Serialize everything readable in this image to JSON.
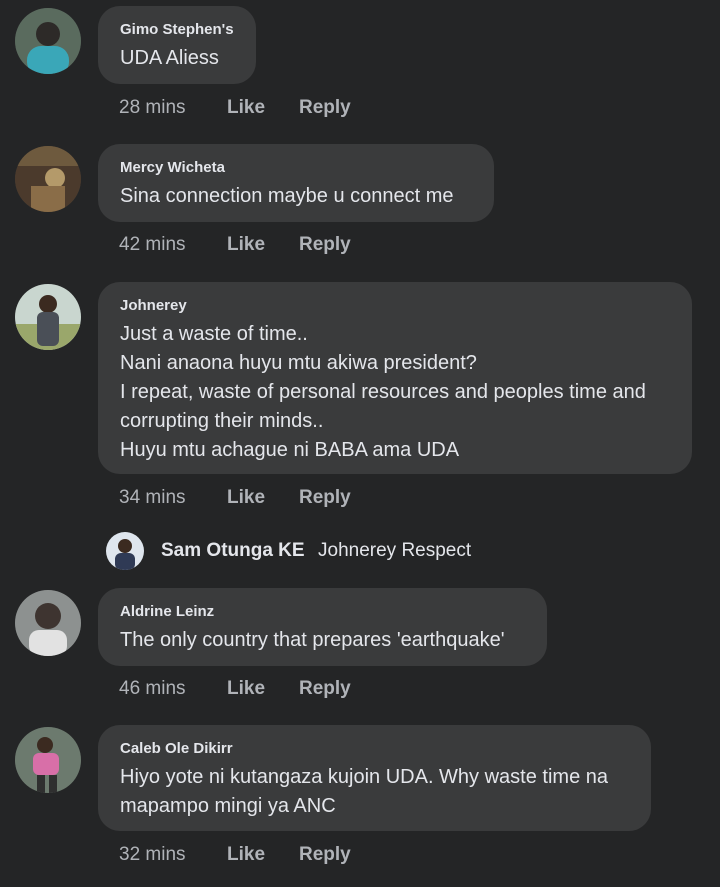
{
  "comments": [
    {
      "author": "Gimo Stephen's",
      "lines": [
        "UDA Aliess"
      ],
      "time": "28 mins",
      "like": "Like",
      "reply": "Reply"
    },
    {
      "author": "Mercy Wicheta",
      "lines": [
        "Sina connection maybe u connect me"
      ],
      "time": "42 mins",
      "like": "Like",
      "reply": "Reply"
    },
    {
      "author": "Johnerey",
      "lines": [
        "Just a waste of time..",
        "Nani anaona huyu mtu akiwa president?",
        "I repeat, waste of personal resources and peoples time and",
        "corrupting their minds..",
        "Huyu mtu achague ni BABA ama UDA"
      ],
      "time": "34 mins",
      "like": "Like",
      "reply": "Reply"
    },
    {
      "author": "Aldrine Leinz",
      "lines": [
        "The only country that prepares 'earthquake'"
      ],
      "time": "46 mins",
      "like": "Like",
      "reply": "Reply"
    },
    {
      "author": "Caleb Ole Dikirr",
      "lines": [
        "Hiyo yote ni kutangaza kujoin UDA. Why waste time na",
        "mapampo mingi ya ANC"
      ],
      "time": "32 mins",
      "like": "Like",
      "reply": "Reply"
    }
  ],
  "reply_preview": {
    "author": "Sam Otunga KE",
    "text": "Johnerey Respect"
  },
  "colors": {
    "background": "#242526",
    "bubble": "#3a3b3c",
    "text": "#e4e6eb",
    "secondary_text": "#b0b3b8"
  }
}
